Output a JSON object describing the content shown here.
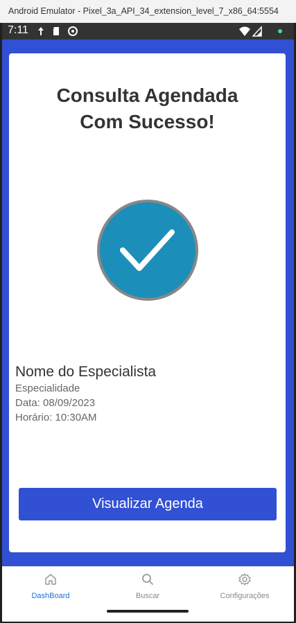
{
  "window": {
    "title": "Android Emulator - Pixel_3a_API_34_extension_level_7_x86_64:5554"
  },
  "status_bar": {
    "time": "7:11",
    "icons": [
      "data-saver-icon",
      "sd-card-icon",
      "sync-icon",
      "wifi-icon",
      "signal-icon",
      "battery-dot-icon"
    ]
  },
  "card": {
    "title_line1": "Consulta Agendada",
    "title_line2": "Com Sucesso!",
    "specialist_name": "Nome do Especialista",
    "specialty": "Especialidade",
    "date": "Data: 08/09/2023",
    "time": "Horário: 10:30AM",
    "button_label": "Visualizar Agenda"
  },
  "tabs": [
    {
      "label": "DashBoard",
      "icon": "home-icon",
      "active": true
    },
    {
      "label": "Buscar",
      "icon": "search-icon",
      "active": false
    },
    {
      "label": "Configurações",
      "icon": "gear-icon",
      "active": false
    }
  ],
  "colors": {
    "primary": "#3150d3",
    "check_circle": "#1b8fba",
    "check_border": "#888888",
    "tab_active": "#1e6fd9",
    "tab_inactive": "#888888"
  }
}
